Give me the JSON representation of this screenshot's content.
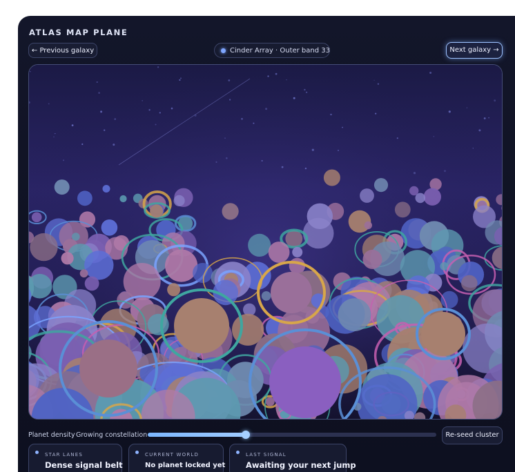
{
  "panel": {
    "title": "ATLAS MAP PLANE"
  },
  "nav": {
    "previous_label": "← Previous galaxy",
    "next_label": "Next galaxy →",
    "location": "Cinder Array · Outer band 33"
  },
  "controls": {
    "density_label": "Planet density",
    "density_value": "Growing constellation",
    "density_level": 0.34,
    "reseed_label": "Re-seed cluster"
  },
  "cards": [
    {
      "title": "STAR LANES",
      "value": "Dense signal belt"
    },
    {
      "title": "CURRENT WORLD",
      "value": "No planet locked yet"
    },
    {
      "title": "LAST SIGNAL",
      "value": "Awaiting your next jump"
    }
  ],
  "colors": {
    "accent": "#7fa6ff",
    "panel_bg": "#13162a",
    "sky_top": "#1a1740",
    "sky_bottom": "#161235"
  }
}
